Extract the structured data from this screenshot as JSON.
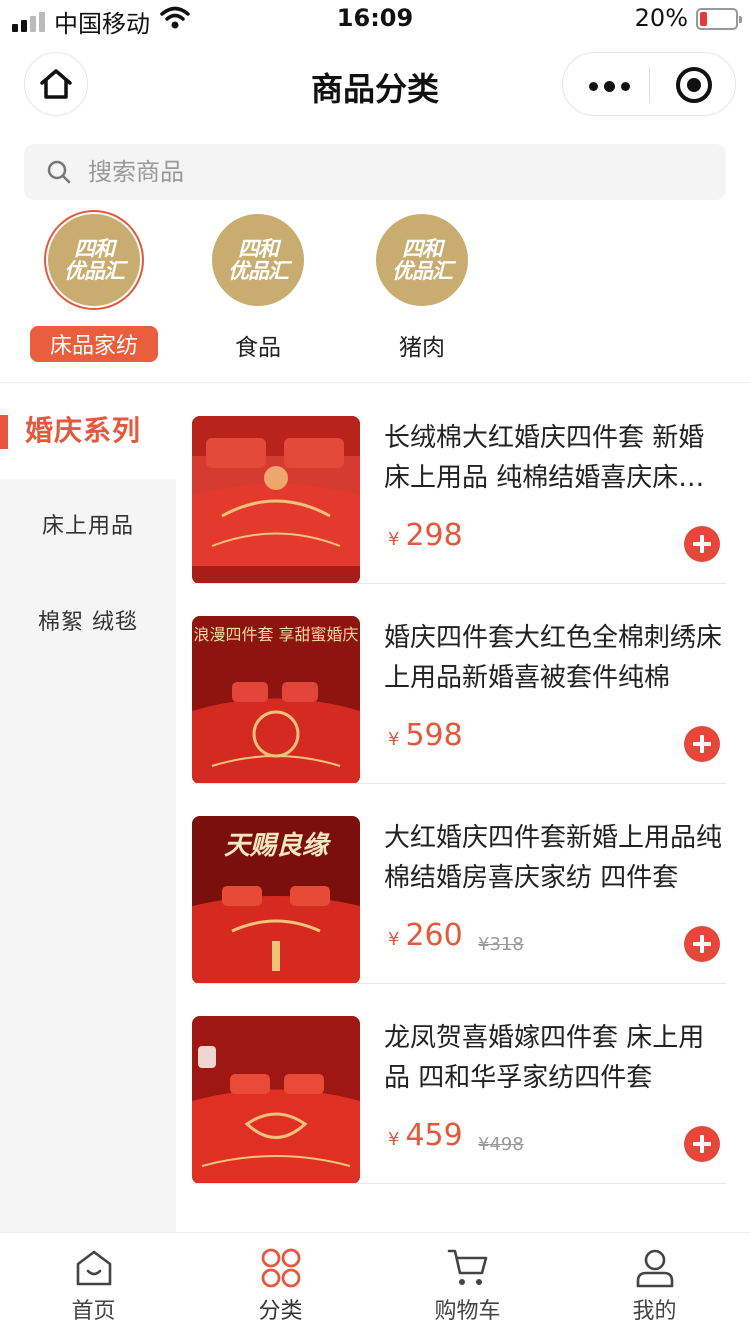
{
  "status_bar": {
    "carrier": "中国移动",
    "time": "16:09",
    "battery": "20%"
  },
  "navbar": {
    "title": "商品分类"
  },
  "search": {
    "placeholder": "搜索商品"
  },
  "top_categories": [
    {
      "logo_line1": "四和",
      "logo_line2": "优品汇",
      "label": "床品家纺",
      "selected": true
    },
    {
      "logo_line1": "四和",
      "logo_line2": "优品汇",
      "label": "食品",
      "selected": false
    },
    {
      "logo_line1": "四和",
      "logo_line2": "优品汇",
      "label": "猪肉",
      "selected": false
    }
  ],
  "sidebar": {
    "items": [
      {
        "label": "婚庆系列",
        "selected": true
      },
      {
        "label": "床上用品",
        "selected": false
      },
      {
        "label": "棉絮 绒毯",
        "selected": false
      }
    ]
  },
  "products": [
    {
      "title": "长绒棉大红婚庆四件套 新婚床上用品 纯棉结婚喜庆床单被套",
      "currency": "¥",
      "price": "298",
      "original_price": ""
    },
    {
      "title": "婚庆四件套大红色全棉刺绣床上用品新婚喜被套件纯棉",
      "currency": "¥",
      "price": "598",
      "original_price": "",
      "thumb_text": "浪漫四件套 享甜蜜婚庆"
    },
    {
      "title": "大红婚庆四件套新婚上用品纯棉结婚房喜庆家纺 四件套",
      "currency": "¥",
      "price": "260",
      "original_price": "¥318",
      "thumb_text": "天赐良缘"
    },
    {
      "title": "龙凤贺喜婚嫁四件套 床上用品 四和华孚家纺四件套",
      "currency": "¥",
      "price": "459",
      "original_price": "¥498"
    }
  ],
  "tabbar": [
    {
      "label": "首页",
      "icon": "home-icon",
      "selected": false
    },
    {
      "label": "分类",
      "icon": "category-icon",
      "selected": true
    },
    {
      "label": "购物车",
      "icon": "cart-icon",
      "selected": false
    },
    {
      "label": "我的",
      "icon": "user-icon",
      "selected": false
    }
  ],
  "colors": {
    "accent": "#e7573c",
    "logo_gold": "#c9ac70",
    "product_red": "#c8231c"
  }
}
